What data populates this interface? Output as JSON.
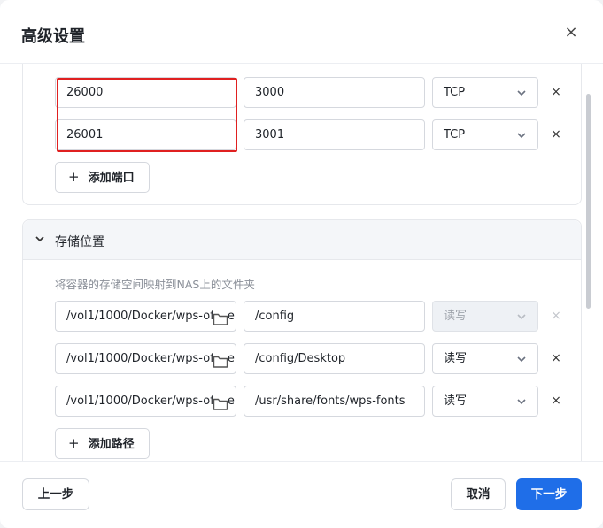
{
  "dialog": {
    "title": "高级设置",
    "close_label": "×"
  },
  "ports": {
    "rows": [
      {
        "host_port": "26000",
        "container_port": "3000",
        "protocol": "TCP",
        "remove": "×"
      },
      {
        "host_port": "26001",
        "container_port": "3001",
        "protocol": "TCP",
        "remove": "×"
      }
    ],
    "add_label": "添加端口",
    "add_icon": "+"
  },
  "storage": {
    "title": "存储位置",
    "hint": "将容器的存储空间映射到NAS上的文件夹",
    "rows": [
      {
        "host_path": "/vol1/1000/Docker/wps-office",
        "container_path": "/config",
        "mode": "读写",
        "disabled": true,
        "remove": "×"
      },
      {
        "host_path": "/vol1/1000/Docker/wps-office",
        "container_path": "/config/Desktop",
        "mode": "读写",
        "disabled": false,
        "remove": "×"
      },
      {
        "host_path": "/vol1/1000/Docker/wps-office",
        "container_path": "/usr/share/fonts/wps-fonts",
        "mode": "读写",
        "disabled": false,
        "remove": "×"
      }
    ],
    "add_label": "添加路径",
    "add_icon": "+"
  },
  "footer": {
    "prev_label": "上一步",
    "cancel_label": "取消",
    "next_label": "下一步"
  },
  "icons": {
    "close": "close-icon",
    "chevron": "chevron-down-icon",
    "folder": "folder-icon",
    "select_arrow": "chevron-down-icon"
  },
  "colors": {
    "primary": "#1f6ee8",
    "highlight": "#e02020",
    "section_header_bg": "#f4f6f9"
  }
}
